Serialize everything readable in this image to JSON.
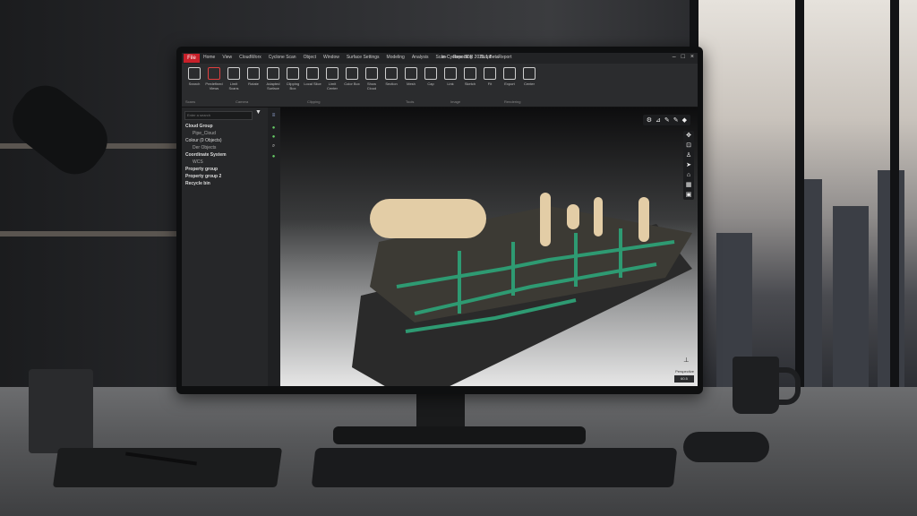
{
  "app": {
    "file_label": "File",
    "title": "In-Cyclone 3DR 2025.1 Beta",
    "menu_tabs": [
      "Home",
      "View",
      "CloudWorx",
      "Cyclone Scan",
      "Object",
      "Window",
      "Surface Settings",
      "Modeling",
      "Analysis",
      "Scan",
      "Reporting",
      "Script",
      "Report"
    ]
  },
  "ribbon": {
    "buttons": [
      "Search",
      "Predefined Views",
      "Limit Scans",
      "Rotate",
      "Adapted Surface",
      "Clipping Box",
      "Local Slice",
      "Limit Center",
      "Color Box",
      "Show Cloud",
      "Section",
      "Mesh",
      "Cap",
      "Link",
      "Sketch",
      "Fit",
      "Export",
      "Center"
    ],
    "groups": [
      "Scans",
      "Camera",
      "Clipping",
      "Tools",
      "Image",
      "Rendering"
    ],
    "toggles": [
      "Show Current",
      "Show Bookmarks",
      "Edit"
    ]
  },
  "tree": {
    "search_placeholder": "Enter a search",
    "items": [
      {
        "label": "Cloud Group",
        "bold": true,
        "sub": false
      },
      {
        "label": "Pipe_Cloud",
        "bold": false,
        "sub": true
      },
      {
        "label": "Colour (0 Objects)",
        "bold": false,
        "sub": false
      },
      {
        "label": "Der Objects",
        "bold": false,
        "sub": true
      },
      {
        "label": "Coordinate System",
        "bold": true,
        "sub": false
      },
      {
        "label": "WCS",
        "bold": false,
        "sub": true
      },
      {
        "label": "Property group",
        "bold": true,
        "sub": false
      },
      {
        "label": "Property group 2",
        "bold": true,
        "sub": false
      },
      {
        "label": "Recycle bin",
        "bold": true,
        "sub": false
      }
    ]
  },
  "viewport": {
    "projection": "Perspective",
    "zoom": "60.5"
  },
  "colors": {
    "accent": "#c8202a",
    "pipe_green": "#2e9a72",
    "tank": "#e3cda6"
  },
  "icons": {
    "search": "magnifier",
    "filter": "funnel",
    "menu": "hamburger"
  }
}
